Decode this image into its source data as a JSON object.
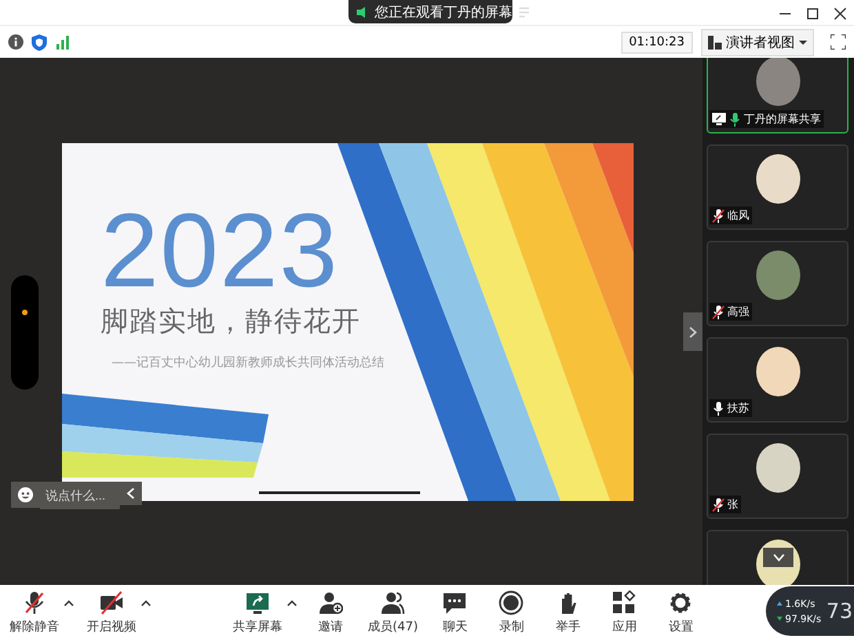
{
  "banner": {
    "text": "您正在观看丁丹的屏幕"
  },
  "toolbar": {
    "time": "01:10:23",
    "view_button": "演讲者视图"
  },
  "slide": {
    "year": "2023",
    "title": "脚踏实地，静待花开",
    "subtitle": "——记百丈中心幼儿园新教师成长共同体活动总结"
  },
  "chat": {
    "placeholder": "说点什么..."
  },
  "participants": [
    {
      "name": "丁丹的屏幕共享",
      "muted": false,
      "sharing": true,
      "selected": true,
      "color": "#8a8580"
    },
    {
      "name": "临风",
      "muted": true,
      "sharing": false,
      "selected": false,
      "color": "#e8dcc8"
    },
    {
      "name": "高强",
      "muted": true,
      "sharing": false,
      "selected": false,
      "color": "#7a8c6a"
    },
    {
      "name": "扶苏",
      "muted": false,
      "sharing": false,
      "selected": false,
      "color": "#f0d8b8"
    },
    {
      "name": "张",
      "muted": true,
      "sharing": false,
      "selected": false,
      "color": "#d8d4c4"
    }
  ],
  "bottom_bar": [
    {
      "kind": "mic",
      "label": "解除静音",
      "menu": true
    },
    {
      "kind": "video",
      "label": "开启视频",
      "menu": true
    },
    {
      "kind": "share",
      "label": "共享屏幕",
      "menu": true
    },
    {
      "kind": "invite",
      "label": "邀请",
      "menu": false
    },
    {
      "kind": "members",
      "label": "成员(47)",
      "menu": false
    },
    {
      "kind": "chat",
      "label": "聊天",
      "menu": false
    },
    {
      "kind": "record",
      "label": "录制",
      "menu": false
    },
    {
      "kind": "hand",
      "label": "举手",
      "menu": false
    },
    {
      "kind": "apps",
      "label": "应用",
      "menu": false
    },
    {
      "kind": "settings",
      "label": "设置",
      "menu": false
    }
  ],
  "network": {
    "upload": "1.6K/s",
    "download": "97.9K/s",
    "gauge": "73"
  }
}
